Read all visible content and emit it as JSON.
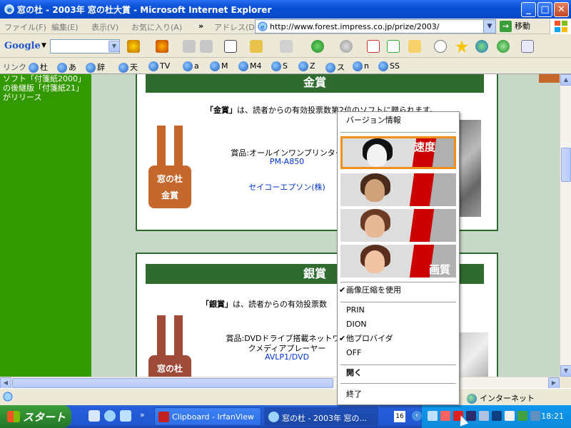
{
  "window": {
    "title": "窓の杜 - 2003年 窓の杜大賞 - Microsoft Internet Explorer",
    "minimize": "_",
    "maximize": "□",
    "close": "✕"
  },
  "menubar": {
    "items": [
      "ファイル(F)",
      "編集(E)",
      "表示(V)",
      "お気に入り(A)"
    ],
    "overflow": "»",
    "address_label": "アドレス(D)",
    "url": "http://www.forest.impress.co.jp/prize/2003/",
    "go_label": "移動"
  },
  "googlebar": {
    "logo": "Google",
    "search_value": ""
  },
  "linksbar": {
    "label": "リンク",
    "items": [
      "杜",
      "あ",
      "辞",
      "天",
      "TV",
      "a",
      "M",
      "M4",
      "S",
      "Z",
      "ス",
      "n",
      "SS"
    ]
  },
  "sidebar": {
    "text": "ソフト「付箋紙2000」の後継版「付箋紙21」がリリース"
  },
  "gold": {
    "heading": "金賞",
    "desc_bold": "「金賞」",
    "desc_rest": "は、読者からの有効投票数第2位のソフトに贈られます。",
    "prize_label": "賞品:オールインワンプリンター",
    "prize_model": "PM-A850",
    "sponsor": "セイコーエプソン(株)",
    "medal_text": "窓の杜",
    "medal_sub": "金賞"
  },
  "silver": {
    "heading": "銀賞",
    "desc_bold": "「銀賞」",
    "desc_rest": "は、読者からの有効投票数",
    "prize_label": "賞品:DVDドライブ搭載ネットワー",
    "prize_label2": "クメディアプレーヤー",
    "prize_model": "AVLP1/DVD",
    "medal_text": "窓の杜"
  },
  "context_menu": {
    "version": "バージョン情報",
    "thumb_speed": "速度",
    "thumb_quality": "画質",
    "compress": "画像圧縮を使用",
    "prin": "PRIN",
    "dion": "DION",
    "other": "他プロバイダ",
    "off": "OFF",
    "open": "開く",
    "exit": "終了"
  },
  "statusbar": {
    "zone": "インターネット"
  },
  "taskbar": {
    "start": "スタート",
    "tasks": [
      "Clipboard - IrfanView",
      "窓の杜 - 2003年 窓の..."
    ],
    "tray_badge": "16",
    "clock": "18:21"
  },
  "colors": {
    "accent_green": "#2f6b2f",
    "sidebar_green": "#339900",
    "menu_selected_border": "#f0901c",
    "speed_red": "#cc0000"
  }
}
